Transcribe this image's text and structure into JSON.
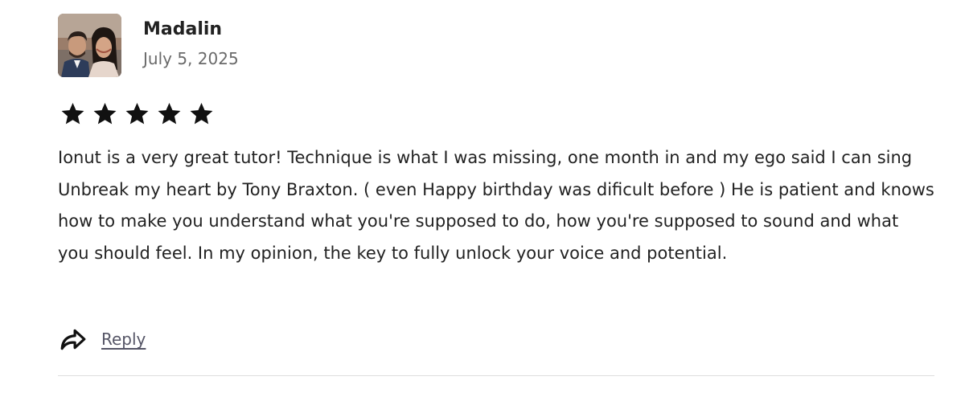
{
  "review": {
    "author_name": "Madalin",
    "date": "July 5, 2025",
    "rating": 5,
    "rating_max": 5,
    "text": "Ionut is a very great tutor! Technique is what I was missing, one month in and my ego said I can sing Unbreak my heart by Tony Braxton. ( even Happy birthday was dificult before ) He is patient and knows how to make you understand what you're supposed to do, how you're supposed to sound and what you should feel. In my opinion, the key to fully unlock your voice and potential."
  },
  "actions": {
    "reply_label": "Reply",
    "reply_icon": "share-arrow-icon"
  },
  "icons": {
    "star": "star-icon"
  },
  "colors": {
    "text": "#222222",
    "muted": "#6a6a6a",
    "star": "#111111",
    "divider": "#dddddd"
  }
}
